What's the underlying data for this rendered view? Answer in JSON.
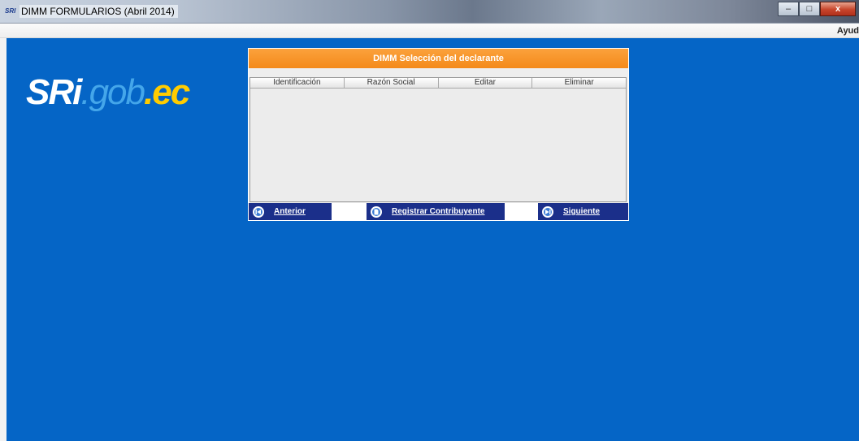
{
  "window": {
    "icon_text": "SRI",
    "title": "DIMM FORMULARIOS (Abril 2014)",
    "minimize_glyph": "–",
    "maximize_glyph": "□",
    "close_glyph": "x"
  },
  "menubar": {
    "items": [
      "Ayud"
    ]
  },
  "logo": {
    "part1": "SRi",
    "part2": ".gob",
    "part3": ".ec"
  },
  "panel": {
    "title": "DIMM Selección del declarante",
    "columns": [
      "Identificación",
      "Razón Social",
      "Editar",
      "Eliminar"
    ],
    "rows": [],
    "buttons": {
      "anterior": "Anterior",
      "registrar": "Registrar Contribuyente",
      "siguiente": "Siguiente"
    }
  },
  "colors": {
    "workspace": "#0565c6",
    "header": "#f48a1a",
    "button": "#1b2f8a"
  }
}
